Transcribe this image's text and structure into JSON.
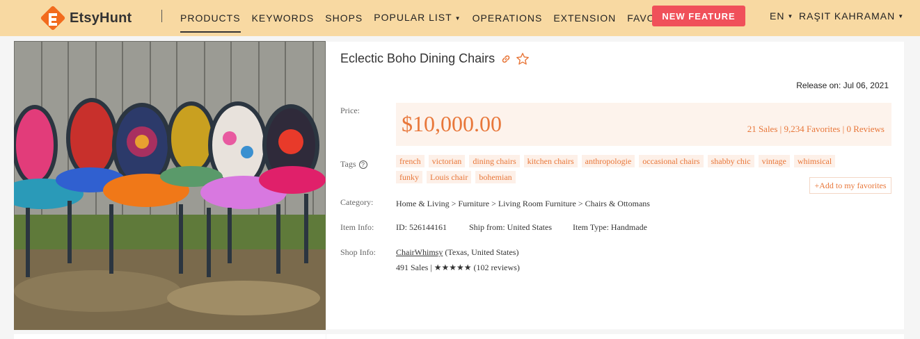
{
  "brand": {
    "name": "EtsyHunt"
  },
  "nav": {
    "items": [
      {
        "label": "PRODUCTS",
        "active": true
      },
      {
        "label": "KEYWORDS"
      },
      {
        "label": "SHOPS"
      },
      {
        "label": "POPULAR LIST",
        "dropdown": true
      },
      {
        "label": "OPERATIONS"
      },
      {
        "label": "EXTENSION"
      },
      {
        "label": "FAVORITES"
      }
    ],
    "new_feature": "NEW FEATURE",
    "language": "EN",
    "user": "RAŞIT KAHRAMAN"
  },
  "product": {
    "title": "Eclectic Boho Dining Chairs",
    "release": "Release on: Jul 06, 2021",
    "labels": {
      "price": "Price:",
      "tags": "Tags",
      "category": "Category:",
      "item_info": "Item Info:",
      "shop_info": "Shop Info:"
    },
    "price": "$10,000.00",
    "stats": "21 Sales | 9,234 Favorites | 0 Reviews",
    "tags": [
      "french",
      "victorian",
      "dining chairs",
      "kitchen chairs",
      "anthropologie",
      "occasional chairs",
      "shabby chic",
      "vintage",
      "whimsical",
      "funky",
      "Louis chair",
      "bohemian"
    ],
    "add_favorite": "+Add to my favorites",
    "category": "Home & Living   > Furniture > Living Room Furniture > Chairs & Ottomans",
    "item_id": "ID: 526144161",
    "ship_from": "Ship from: United States",
    "item_type": "Item Type: Handmade",
    "shop_name": "ChairWhimsy",
    "shop_location": " (Texas, United States)",
    "shop_stats": "491 Sales | ★★★★★ (102 reviews)"
  },
  "colors": {
    "topbar": "#f8d9a2",
    "accent": "#e8773a",
    "new_feature_bg": "#f0505a"
  }
}
